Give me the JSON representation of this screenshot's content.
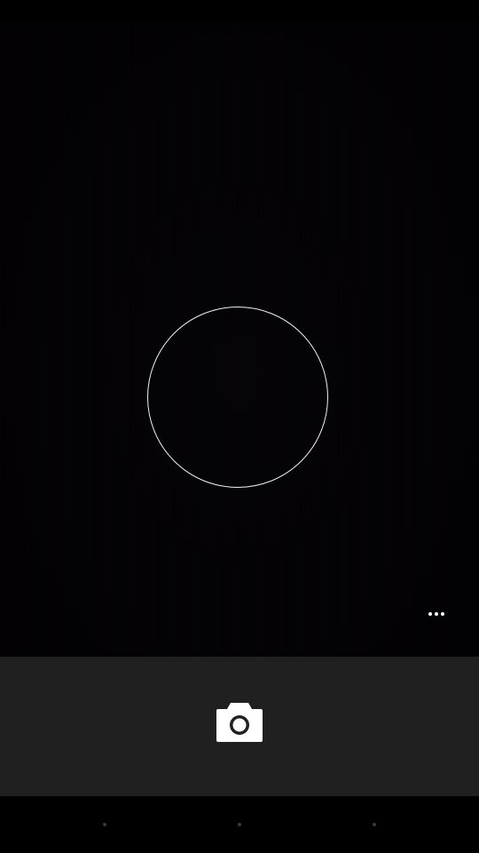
{
  "app": {
    "screen": "camera-viewfinder"
  },
  "viewfinder": {
    "focus_indicator": "focus-ring"
  },
  "overflow_menu": {
    "icon": "more-horizontal-icon"
  },
  "shutter": {
    "icon": "camera-icon"
  },
  "navigation": {
    "items": [
      {
        "icon": "back-icon"
      },
      {
        "icon": "home-icon"
      },
      {
        "icon": "recents-icon"
      }
    ]
  },
  "colors": {
    "control_bar": "#202020",
    "focus_ring": "#f2f2f2",
    "background": "#000000"
  }
}
